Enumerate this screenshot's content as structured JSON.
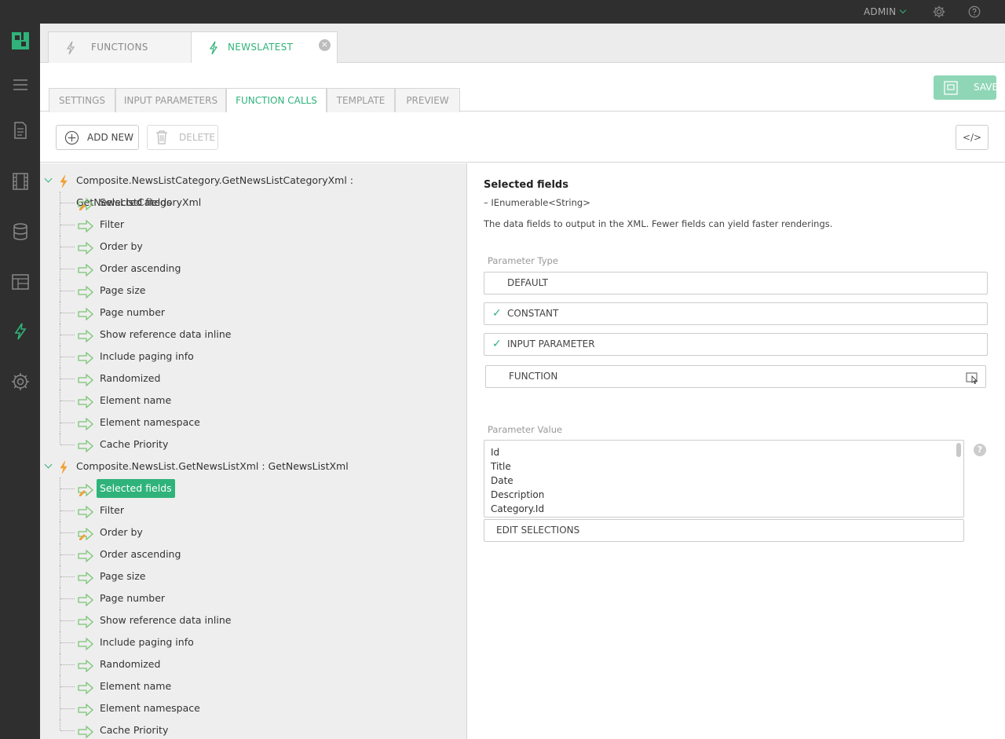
{
  "topbar": {
    "user": "ADMIN"
  },
  "tabs": [
    {
      "label": "FUNCTIONS",
      "active": false
    },
    {
      "label": "NEWSLATEST",
      "active": true
    }
  ],
  "subtabs": [
    "SETTINGS",
    "INPUT PARAMETERS",
    "FUNCTION CALLS",
    "TEMPLATE",
    "PREVIEW"
  ],
  "active_subtab": "FUNCTION CALLS",
  "save_label": "SAVE",
  "toolbar": {
    "add_label": "ADD NEW",
    "delete_label": "DELETE",
    "code_label": "</>"
  },
  "tree": {
    "groups": [
      {
        "title": "Composite.NewsListCategory.GetNewsListCategoryXml : GetNewsListCategoryXml",
        "items": [
          "Selected fields",
          "Filter",
          "Order by",
          "Order ascending",
          "Page size",
          "Page number",
          "Show reference data inline",
          "Include paging info",
          "Randomized",
          "Element name",
          "Element namespace",
          "Cache Priority"
        ]
      },
      {
        "title": "Composite.NewsList.GetNewsListXml : GetNewsListXml",
        "items": [
          "Selected fields",
          "Filter",
          "Order by",
          "Order ascending",
          "Page size",
          "Page number",
          "Show reference data inline",
          "Include paging info",
          "Randomized",
          "Element name",
          "Element namespace",
          "Cache Priority"
        ]
      }
    ],
    "selected": "Selected fields"
  },
  "detail": {
    "title": "Selected fields",
    "type": "IEnumerable<String>",
    "type_prefix": "–",
    "description": "The data fields to output in the XML. Fewer fields can yield faster renderings.",
    "param_type_label": "Parameter Type",
    "param_types": [
      {
        "label": "DEFAULT",
        "checked": false
      },
      {
        "label": "CONSTANT",
        "checked": true
      },
      {
        "label": "INPUT PARAMETER",
        "checked": true
      },
      {
        "label": "FUNCTION",
        "checked": false
      }
    ],
    "param_value_label": "Parameter Value",
    "values": [
      "Id",
      "Title",
      "Date",
      "Description",
      "Category.Id"
    ],
    "edit_selections": "EDIT SELECTIONS",
    "help": "?",
    "check": "✓"
  },
  "colors": {
    "accent": "#2fb37a",
    "dark": "#2f2f2f",
    "lightning": "#f0a030"
  }
}
